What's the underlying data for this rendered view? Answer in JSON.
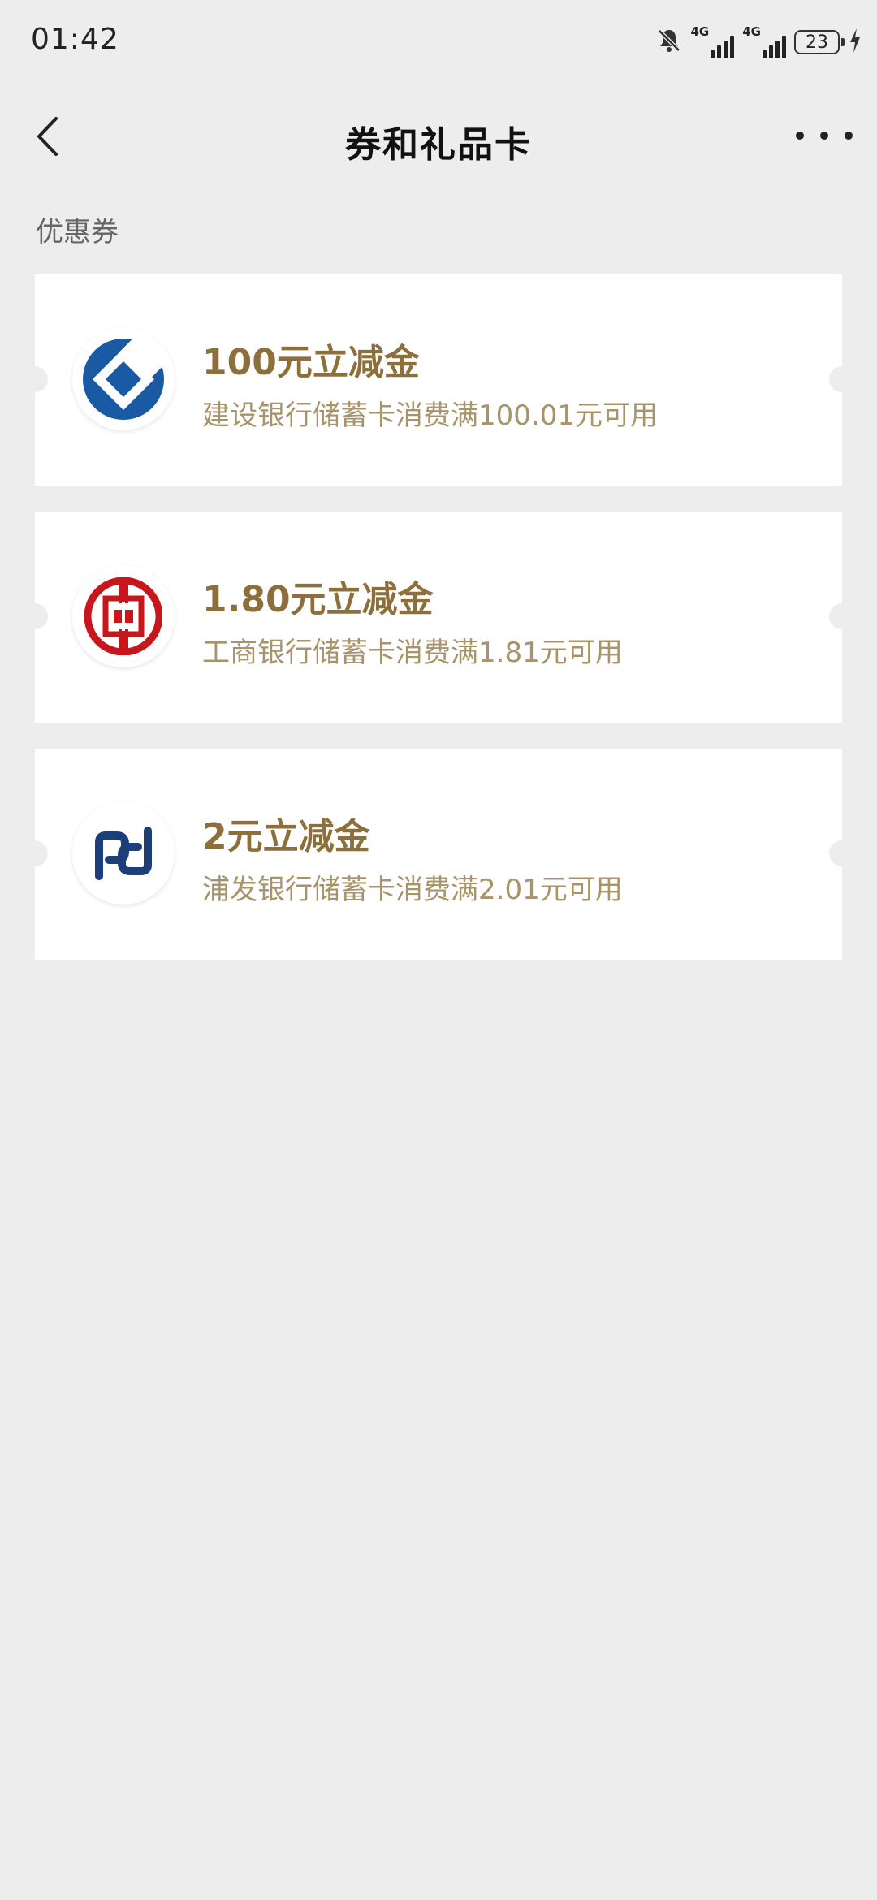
{
  "status_bar": {
    "time": "01:42",
    "network1": "4G",
    "network2": "4G",
    "battery": "23"
  },
  "nav": {
    "title": "券和礼品卡"
  },
  "section": {
    "label": "优惠券"
  },
  "coupons": [
    {
      "title": "100元立减金",
      "desc": "建设银行储蓄卡消费满100.01元可用",
      "bank_icon": "ccb-logo-icon"
    },
    {
      "title": "1.80元立减金",
      "desc": "工商银行储蓄卡消费满1.81元可用",
      "bank_icon": "icbc-logo-icon"
    },
    {
      "title": "2元立减金",
      "desc": "浦发银行储蓄卡消费满2.01元可用",
      "bank_icon": "spdb-logo-icon"
    }
  ],
  "colors": {
    "background": "#ededed",
    "coupon_title": "#8c6f3a",
    "coupon_desc": "#a8946b",
    "ccb_blue": "#1a5aa5",
    "icbc_red": "#c8161d",
    "spdb_navy": "#1c3f7a"
  }
}
